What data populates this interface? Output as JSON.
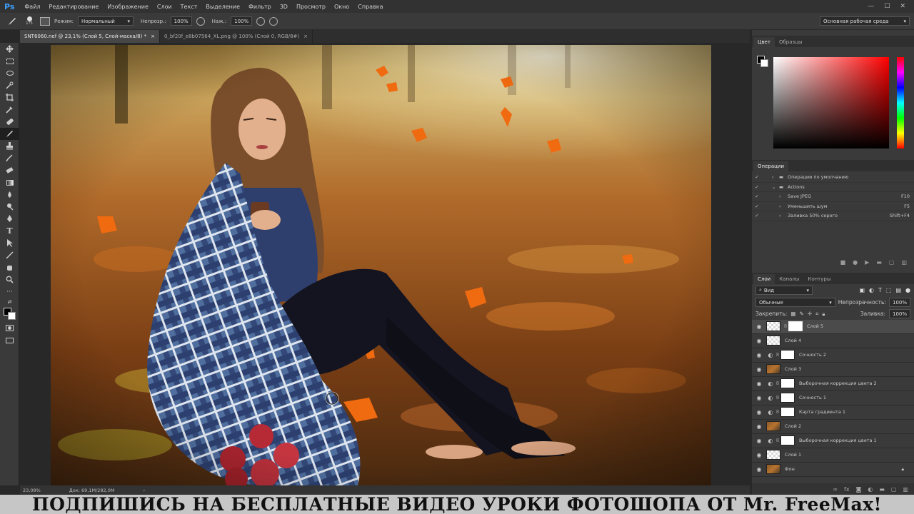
{
  "app": {
    "logo": "Ps"
  },
  "menu": [
    "Файл",
    "Редактирование",
    "Изображение",
    "Слои",
    "Текст",
    "Выделение",
    "Фильтр",
    "3D",
    "Просмотр",
    "Окно",
    "Справка"
  ],
  "window_controls": [
    "—",
    "☐",
    "✕"
  ],
  "options": {
    "brush_size": "175",
    "mode_label": "Режим:",
    "mode_value": "Нормальный",
    "opacity_label": "Непрозр.:",
    "opacity_value": "100%",
    "pressure_label": "Наж.:",
    "pressure_value": "100%",
    "workspace": "Основная рабочая среда"
  },
  "doc_tabs": [
    {
      "label": "SNT6060.nef @ 23,1% (Слой 5, Слой-маска/8) *",
      "close": "×"
    },
    {
      "label": "0_bf20f_e8b07564_XL.png @ 100% (Слой 0, RGB/8#)",
      "close": "×"
    }
  ],
  "status": {
    "zoom": "23,08%",
    "doc": "Док: 69,1M/282,0M",
    "arrow": "›"
  },
  "color_panel": {
    "tabs": [
      "Цвет",
      "Образцы"
    ]
  },
  "actions_panel": {
    "tab": "Операции",
    "rows": [
      {
        "label": "Операции по умолчанию",
        "shortcut": ""
      },
      {
        "label": "Actions",
        "shortcut": ""
      },
      {
        "label": "Save JPEG",
        "shortcut": "F10"
      },
      {
        "label": "Уменьшить шум",
        "shortcut": "F5"
      },
      {
        "label": "Заливка 50% серого",
        "shortcut": "Shift+F4"
      }
    ]
  },
  "layers_panel": {
    "tabs": [
      "Слои",
      "Каналы",
      "Контуры"
    ],
    "filter": "Вид",
    "blend_mode": "Обычные",
    "opacity_label": "Непрозрачность:",
    "opacity_value": "100%",
    "lock_label": "Закрепить:",
    "fill_label": "Заливка:",
    "fill_value": "100%",
    "layers": [
      {
        "name": "Слой 5",
        "thumb": "checker",
        "mask": true,
        "adj": false,
        "selected": true,
        "lock": false
      },
      {
        "name": "Слой 4",
        "thumb": "checker",
        "mask": false,
        "adj": false,
        "selected": false,
        "lock": false
      },
      {
        "name": "Сочность 2",
        "thumb": "white",
        "mask": true,
        "adj": true,
        "selected": false,
        "lock": false
      },
      {
        "name": "Слой 3",
        "thumb": "photo",
        "mask": false,
        "adj": false,
        "selected": false,
        "lock": false
      },
      {
        "name": "Выборочная коррекция цвета 2",
        "thumb": "white",
        "mask": true,
        "adj": true,
        "selected": false,
        "lock": false
      },
      {
        "name": "Сочность 1",
        "thumb": "white",
        "mask": true,
        "adj": true,
        "selected": false,
        "lock": false
      },
      {
        "name": "Карта градиента 1",
        "thumb": "white",
        "mask": true,
        "adj": true,
        "selected": false,
        "lock": false
      },
      {
        "name": "Слой 2",
        "thumb": "photo",
        "mask": false,
        "adj": false,
        "selected": false,
        "lock": false
      },
      {
        "name": "Выборочная коррекция цвета 1",
        "thumb": "white",
        "mask": true,
        "adj": true,
        "selected": false,
        "lock": false
      },
      {
        "name": "Слой 1",
        "thumb": "checker",
        "mask": false,
        "adj": false,
        "selected": false,
        "lock": false
      },
      {
        "name": "Фон",
        "thumb": "photo",
        "mask": false,
        "adj": false,
        "selected": false,
        "lock": true
      }
    ]
  },
  "banner": "ПОДПИШИСЬ НА БЕСПЛАТНЫЕ ВИДЕО УРОКИ ФОТОШОПА ОТ Mr. FreeMax!"
}
